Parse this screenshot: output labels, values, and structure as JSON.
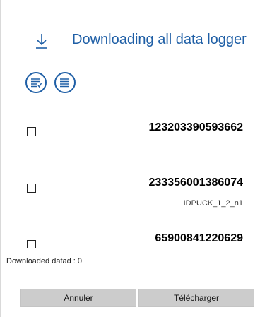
{
  "header": {
    "title": "Downloading all data logger",
    "icon": "download-arrow-icon"
  },
  "toolbar": {
    "buttons": [
      {
        "icon": "select-all-list-icon"
      },
      {
        "icon": "deselect-list-icon"
      }
    ]
  },
  "loggers": [
    {
      "serial": "123203390593662",
      "subtitle": "",
      "checked": false
    },
    {
      "serial": "233356001386074",
      "subtitle": "IDPUCK_1_2_n1",
      "checked": false
    },
    {
      "serial": "65900841220629",
      "subtitle": "",
      "checked": false
    }
  ],
  "status": {
    "text": "Downloaded datad : 0"
  },
  "actions": {
    "cancel_label": "Annuler",
    "download_label": "Télécharger"
  },
  "colors": {
    "accent": "#1f5fa6",
    "button_bg": "#cccccc"
  }
}
